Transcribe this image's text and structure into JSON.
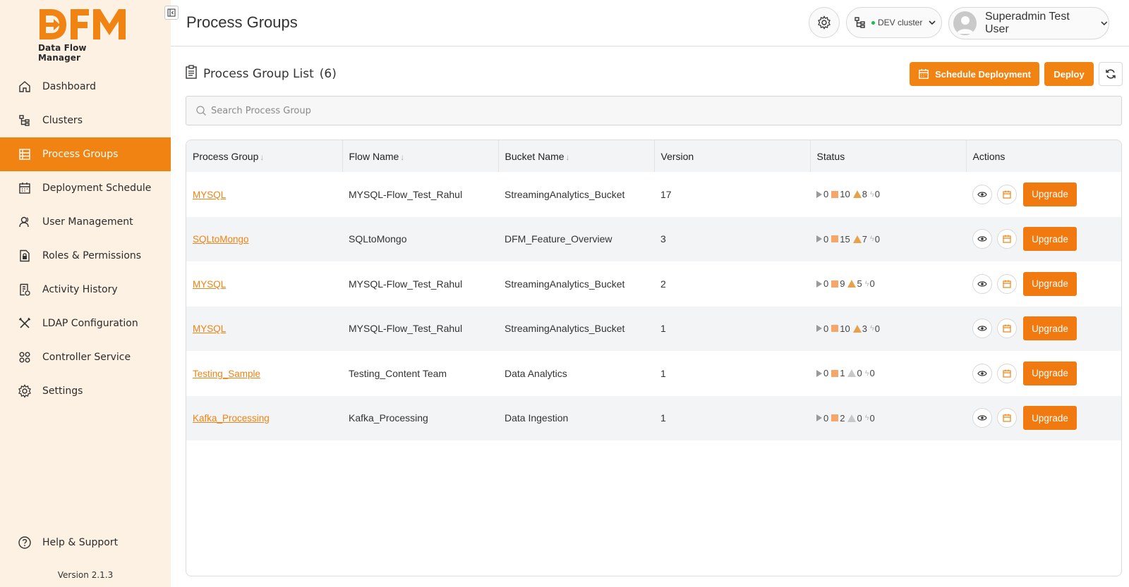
{
  "brand": {
    "logo_text": "DFM",
    "subtitle": "Data Flow Manager",
    "primary_color": "#f08312"
  },
  "sidebar": {
    "items": [
      {
        "label": "Dashboard",
        "icon": "home-icon",
        "active": false
      },
      {
        "label": "Clusters",
        "icon": "cluster-icon",
        "active": false
      },
      {
        "label": "Process Groups",
        "icon": "list-icon",
        "active": true
      },
      {
        "label": "Deployment Schedule",
        "icon": "calendar-icon",
        "active": false
      },
      {
        "label": "User Management",
        "icon": "users-icon",
        "active": false
      },
      {
        "label": "Roles & Permissions",
        "icon": "lock-doc-icon",
        "active": false
      },
      {
        "label": "Activity History",
        "icon": "history-icon",
        "active": false
      },
      {
        "label": "LDAP Configuration",
        "icon": "tools-icon",
        "active": false
      },
      {
        "label": "Controller Service",
        "icon": "services-icon",
        "active": false
      },
      {
        "label": "Settings",
        "icon": "gear-icon",
        "active": false
      }
    ],
    "help_label": "Help & Support",
    "version": "Version 2.1.3"
  },
  "header": {
    "title": "Process Groups",
    "cluster": "DEV cluster",
    "user": "Superadmin Test User"
  },
  "list": {
    "title": "Process Group List",
    "count": "(6)",
    "schedule_label": "Schedule Deployment",
    "deploy_label": "Deploy",
    "search_placeholder": "Search Process Group"
  },
  "table": {
    "columns": [
      "Process Group",
      "Flow Name",
      "Bucket Name",
      "Version",
      "Status",
      "Actions"
    ],
    "upgrade_label": "Upgrade",
    "rows": [
      {
        "process_group": "MYSQL",
        "flow": "MYSQL-Flow_Test_Rahul",
        "bucket": "StreamingAnalytics_Bucket",
        "version": "17",
        "running": "0",
        "stopped": "10",
        "invalid": "8",
        "disabled": "0"
      },
      {
        "process_group": "SQLtoMongo",
        "flow": "SQLtoMongo",
        "bucket": "DFM_Feature_Overview",
        "version": "3",
        "running": "0",
        "stopped": "15",
        "invalid": "7",
        "disabled": "0"
      },
      {
        "process_group": "MYSQL",
        "flow": "MYSQL-Flow_Test_Rahul",
        "bucket": "StreamingAnalytics_Bucket",
        "version": "2",
        "running": "0",
        "stopped": "9",
        "invalid": "5",
        "disabled": "0"
      },
      {
        "process_group": "MYSQL",
        "flow": "MYSQL-Flow_Test_Rahul",
        "bucket": "StreamingAnalytics_Bucket",
        "version": "1",
        "running": "0",
        "stopped": "10",
        "invalid": "3",
        "disabled": "0"
      },
      {
        "process_group": "Testing_Sample",
        "flow": "Testing_Content Team",
        "bucket": "Data Analytics",
        "version": "1",
        "running": "0",
        "stopped": "1",
        "invalid": "0",
        "disabled": "0"
      },
      {
        "process_group": "Kafka_Processing",
        "flow": "Kafka_Processing",
        "bucket": "Data Ingestion",
        "version": "1",
        "running": "0",
        "stopped": "2",
        "invalid": "0",
        "disabled": "0"
      }
    ]
  }
}
